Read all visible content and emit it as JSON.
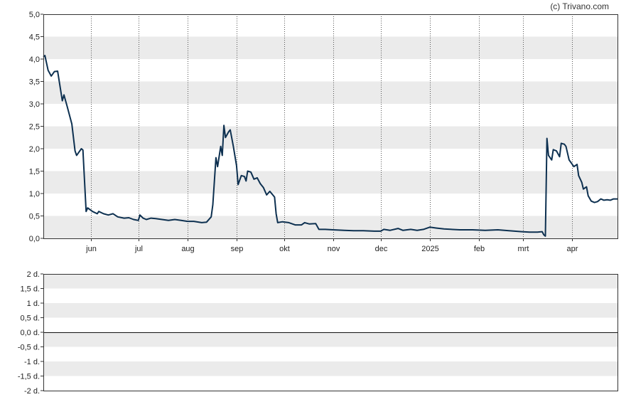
{
  "credit": "(c) Trivano.com",
  "colors": {
    "line": "#0d3050",
    "band": "#ebebeb",
    "grid": "#555555",
    "frame": "#333333",
    "zero": "#111111"
  },
  "chart_data": [
    {
      "type": "line",
      "ylim": [
        0,
        5
      ],
      "yticks": [
        "0,0",
        "0,5",
        "1,0",
        "1,5",
        "2,0",
        "2,5",
        "3,0",
        "3,5",
        "4,0",
        "4,5",
        "5,0"
      ],
      "x_domain": [
        "2024-05-02",
        "2025-04-30"
      ],
      "xticks": [
        {
          "date": "2024-06-01",
          "label": "jun"
        },
        {
          "date": "2024-07-01",
          "label": "jul"
        },
        {
          "date": "2024-08-01",
          "label": "aug"
        },
        {
          "date": "2024-09-01",
          "label": "sep"
        },
        {
          "date": "2024-10-01",
          "label": "okt"
        },
        {
          "date": "2024-11-01",
          "label": "nov"
        },
        {
          "date": "2024-12-01",
          "label": "dec"
        },
        {
          "date": "2025-01-01",
          "label": "2025"
        },
        {
          "date": "2025-02-01",
          "label": "feb"
        },
        {
          "date": "2025-03-01",
          "label": "mrt"
        },
        {
          "date": "2025-04-01",
          "label": "apr"
        }
      ],
      "grid": true,
      "series": [
        {
          "points": [
            [
              "2024-05-02",
              4.05
            ],
            [
              "2024-05-03",
              4.08
            ],
            [
              "2024-05-05",
              3.75
            ],
            [
              "2024-05-07",
              3.62
            ],
            [
              "2024-05-09",
              3.72
            ],
            [
              "2024-05-11",
              3.73
            ],
            [
              "2024-05-14",
              3.07
            ],
            [
              "2024-05-15",
              3.2
            ],
            [
              "2024-05-17",
              2.95
            ],
            [
              "2024-05-20",
              2.55
            ],
            [
              "2024-05-22",
              1.95
            ],
            [
              "2024-05-23",
              1.85
            ],
            [
              "2024-05-26",
              2.0
            ],
            [
              "2024-05-27",
              1.97
            ],
            [
              "2024-05-29",
              0.6
            ],
            [
              "2024-05-30",
              0.68
            ],
            [
              "2024-06-02",
              0.6
            ],
            [
              "2024-06-05",
              0.55
            ],
            [
              "2024-06-06",
              0.6
            ],
            [
              "2024-06-09",
              0.55
            ],
            [
              "2024-06-12",
              0.52
            ],
            [
              "2024-06-15",
              0.55
            ],
            [
              "2024-06-18",
              0.48
            ],
            [
              "2024-06-22",
              0.45
            ],
            [
              "2024-06-25",
              0.46
            ],
            [
              "2024-06-28",
              0.42
            ],
            [
              "2024-07-01",
              0.4
            ],
            [
              "2024-07-02",
              0.52
            ],
            [
              "2024-07-04",
              0.45
            ],
            [
              "2024-07-06",
              0.42
            ],
            [
              "2024-07-09",
              0.45
            ],
            [
              "2024-07-12",
              0.44
            ],
            [
              "2024-07-16",
              0.42
            ],
            [
              "2024-07-20",
              0.4
            ],
            [
              "2024-07-24",
              0.42
            ],
            [
              "2024-07-28",
              0.4
            ],
            [
              "2024-08-01",
              0.38
            ],
            [
              "2024-08-05",
              0.38
            ],
            [
              "2024-08-10",
              0.35
            ],
            [
              "2024-08-13",
              0.36
            ],
            [
              "2024-08-16",
              0.48
            ],
            [
              "2024-08-17",
              0.75
            ],
            [
              "2024-08-19",
              1.8
            ],
            [
              "2024-08-20",
              1.6
            ],
            [
              "2024-08-22",
              2.05
            ],
            [
              "2024-08-23",
              1.85
            ],
            [
              "2024-08-24",
              2.52
            ],
            [
              "2024-08-25",
              2.25
            ],
            [
              "2024-08-27",
              2.38
            ],
            [
              "2024-08-28",
              2.42
            ],
            [
              "2024-08-30",
              2.05
            ],
            [
              "2024-09-01",
              1.62
            ],
            [
              "2024-09-02",
              1.2
            ],
            [
              "2024-09-04",
              1.4
            ],
            [
              "2024-09-06",
              1.38
            ],
            [
              "2024-09-07",
              1.28
            ],
            [
              "2024-09-08",
              1.5
            ],
            [
              "2024-09-10",
              1.48
            ],
            [
              "2024-09-12",
              1.32
            ],
            [
              "2024-09-14",
              1.35
            ],
            [
              "2024-09-16",
              1.22
            ],
            [
              "2024-09-18",
              1.13
            ],
            [
              "2024-09-20",
              0.97
            ],
            [
              "2024-09-22",
              1.05
            ],
            [
              "2024-09-25",
              0.92
            ],
            [
              "2024-09-26",
              0.55
            ],
            [
              "2024-09-27",
              0.35
            ],
            [
              "2024-09-30",
              0.37
            ],
            [
              "2024-10-04",
              0.35
            ],
            [
              "2024-10-08",
              0.3
            ],
            [
              "2024-10-12",
              0.3
            ],
            [
              "2024-10-14",
              0.35
            ],
            [
              "2024-10-17",
              0.32
            ],
            [
              "2024-10-21",
              0.33
            ],
            [
              "2024-10-23",
              0.2
            ],
            [
              "2024-10-27",
              0.2
            ],
            [
              "2024-11-01",
              0.19
            ],
            [
              "2024-11-08",
              0.18
            ],
            [
              "2024-11-14",
              0.17
            ],
            [
              "2024-11-20",
              0.17
            ],
            [
              "2024-11-27",
              0.16
            ],
            [
              "2024-12-01",
              0.16
            ],
            [
              "2024-12-03",
              0.2
            ],
            [
              "2024-12-07",
              0.18
            ],
            [
              "2024-12-12",
              0.22
            ],
            [
              "2024-12-15",
              0.18
            ],
            [
              "2024-12-20",
              0.2
            ],
            [
              "2024-12-24",
              0.18
            ],
            [
              "2024-12-28",
              0.2
            ],
            [
              "2025-01-01",
              0.25
            ],
            [
              "2025-01-05",
              0.23
            ],
            [
              "2025-01-10",
              0.21
            ],
            [
              "2025-01-20",
              0.19
            ],
            [
              "2025-01-28",
              0.19
            ],
            [
              "2025-02-05",
              0.18
            ],
            [
              "2025-02-13",
              0.19
            ],
            [
              "2025-02-20",
              0.17
            ],
            [
              "2025-02-28",
              0.15
            ],
            [
              "2025-03-05",
              0.14
            ],
            [
              "2025-03-10",
              0.14
            ],
            [
              "2025-03-13",
              0.15
            ],
            [
              "2025-03-14",
              0.08
            ],
            [
              "2025-03-15",
              0.05
            ],
            [
              "2025-03-16",
              2.23
            ],
            [
              "2025-03-17",
              1.85
            ],
            [
              "2025-03-19",
              1.75
            ],
            [
              "2025-03-20",
              1.98
            ],
            [
              "2025-03-22",
              1.95
            ],
            [
              "2025-03-24",
              1.82
            ],
            [
              "2025-03-25",
              2.12
            ],
            [
              "2025-03-27",
              2.1
            ],
            [
              "2025-03-28",
              2.05
            ],
            [
              "2025-03-30",
              1.75
            ],
            [
              "2025-04-01",
              1.65
            ],
            [
              "2025-04-02",
              1.6
            ],
            [
              "2025-04-04",
              1.65
            ],
            [
              "2025-04-05",
              1.4
            ],
            [
              "2025-04-07",
              1.25
            ],
            [
              "2025-04-08",
              1.1
            ],
            [
              "2025-04-10",
              1.15
            ],
            [
              "2025-04-11",
              0.95
            ],
            [
              "2025-04-13",
              0.83
            ],
            [
              "2025-04-15",
              0.8
            ],
            [
              "2025-04-17",
              0.82
            ],
            [
              "2025-04-19",
              0.88
            ],
            [
              "2025-04-21",
              0.85
            ],
            [
              "2025-04-23",
              0.86
            ],
            [
              "2025-04-25",
              0.85
            ],
            [
              "2025-04-27",
              0.88
            ],
            [
              "2025-04-30",
              0.88
            ]
          ]
        }
      ]
    },
    {
      "type": "line",
      "ylim": [
        -2,
        2
      ],
      "yticks": [
        "-2 d.",
        "-1,5 d.",
        "-1 d.",
        "-0,5 d.",
        "0,0 d.",
        "0,5 d.",
        "1 d.",
        "1,5 d.",
        "2 d."
      ],
      "grid": true,
      "series": []
    }
  ]
}
